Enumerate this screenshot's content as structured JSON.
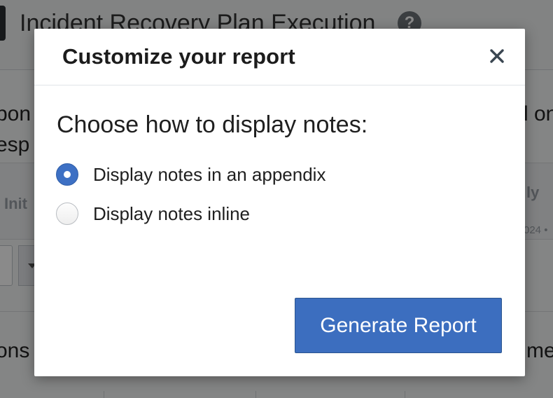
{
  "background": {
    "page_title": "Incident Recovery Plan Execution",
    "help_icon_glyph": "?",
    "text_left_line1": "pon",
    "text_left_line2": "esp",
    "text_right_line1": "l on",
    "column_left_label": "Init",
    "column_right_label": "ly",
    "date_right": "024 •",
    "row_left_text": "ons",
    "row_right_text": "med"
  },
  "modal": {
    "title": "Customize your report",
    "close_glyph": "×",
    "prompt": "Choose how to display notes:",
    "options": [
      {
        "label": "Display notes in an appendix",
        "selected": true
      },
      {
        "label": "Display notes inline",
        "selected": false
      }
    ],
    "generate_label": "Generate Report"
  },
  "colors": {
    "accent": "#3c6ebf",
    "overlay": "rgba(0,0,0,0.46)"
  }
}
